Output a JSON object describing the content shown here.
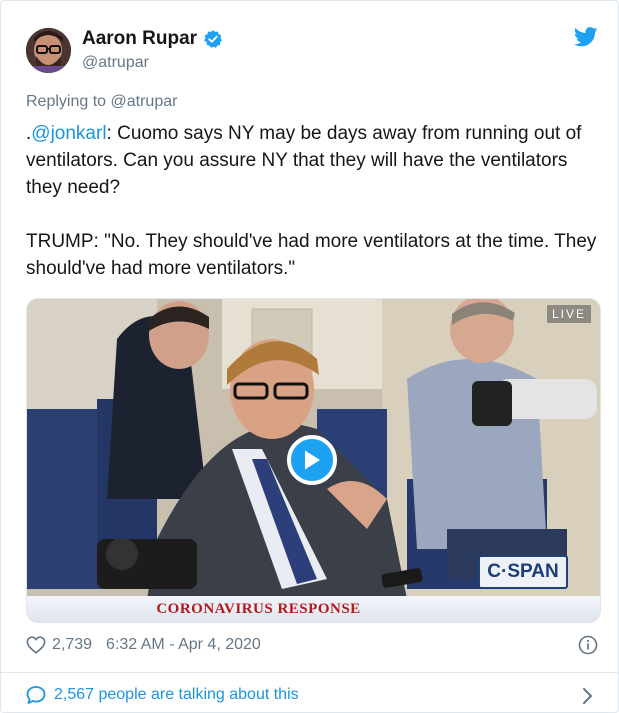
{
  "author": {
    "name": "Aaron Rupar",
    "handle": "@atrupar",
    "verified": true
  },
  "reply": {
    "prefix": "Replying to ",
    "to": "@atrupar"
  },
  "tweet": {
    "lead": ".",
    "mention": "@jonkarl",
    "body": ": Cuomo says NY may be days away from running out of ventilators. Can you assure NY that they will have the ventilators they need?\n\nTRUMP: \"No. They should've had more ventilators at the time. They should've had more ventilators.\""
  },
  "video": {
    "live_label": "LIVE",
    "network_logo": "C·SPAN",
    "banner": "CORONAVIRUS RESPONSE"
  },
  "stats": {
    "likes": "2,739",
    "timestamp": "6:32 AM - Apr 4, 2020"
  },
  "conversation": {
    "label": "2,567 people are talking about this"
  },
  "icons": {
    "brand": "twitter-bird-icon",
    "verified": "verified-badge-icon",
    "like": "heart-icon",
    "info": "info-icon",
    "reply": "speech-bubble-icon",
    "chevron": "chevron-right-icon",
    "play": "play-icon"
  },
  "colors": {
    "accent": "#1da1f2",
    "link": "#1b95e0",
    "muted": "#657786",
    "banner_text": "#b3181b"
  }
}
